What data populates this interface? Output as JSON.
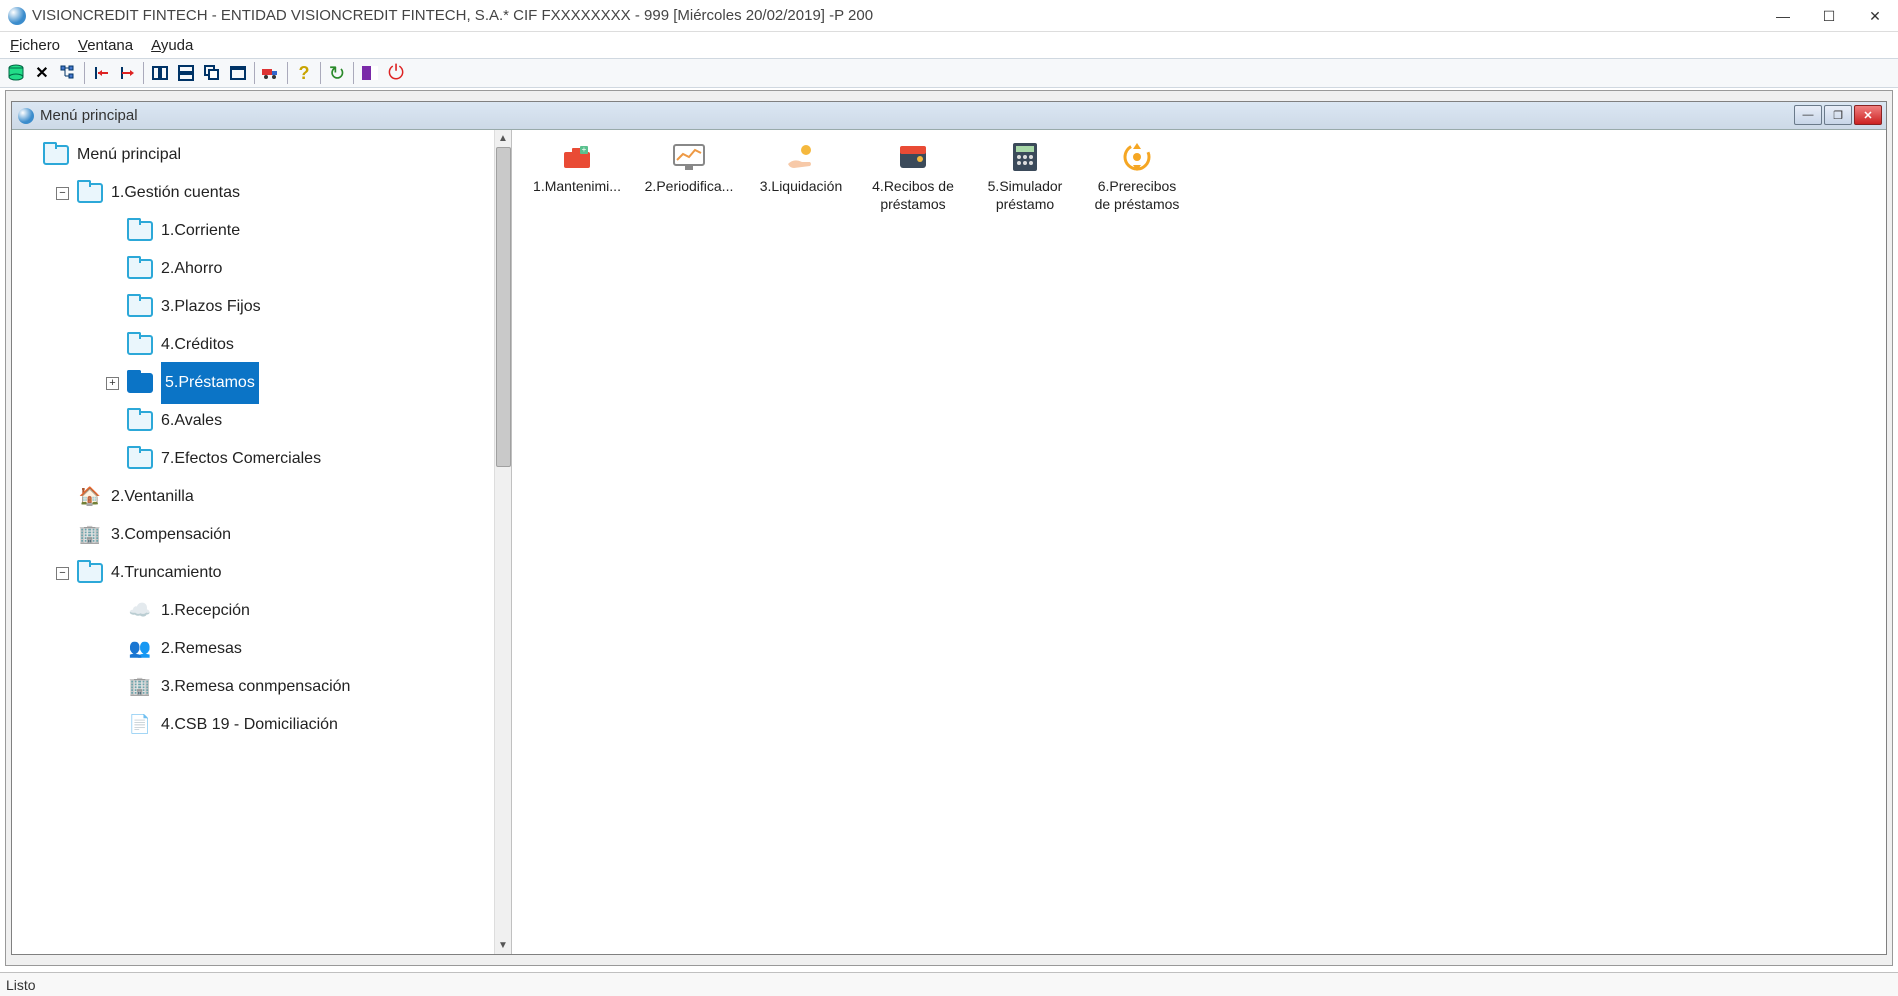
{
  "window": {
    "title": "VISIONCREDIT FINTECH - ENTIDAD VISIONCREDIT FINTECH, S.A.* CIF FXXXXXXXX - 999 [Miércoles 20/02/2019] -P 200"
  },
  "menubar": {
    "fichero": "Fichero",
    "ventana": "Ventana",
    "ayuda": "Ayuda"
  },
  "toolbar": {
    "buttons": [
      "db",
      "delete",
      "tree",
      "indent-left",
      "indent-right",
      "cols",
      "rows",
      "cascade",
      "tile",
      "truck",
      "help",
      "refresh",
      "panel1",
      "panel2"
    ]
  },
  "subwindow": {
    "title": "Menú principal"
  },
  "tree": {
    "root": "Menú principal",
    "node_gestion": "1.Gestión cuentas",
    "leaf_corriente": "1.Corriente",
    "leaf_ahorro": "2.Ahorro",
    "leaf_plazos": "3.Plazos Fijos",
    "leaf_creditos": "4.Créditos",
    "leaf_prestamos": "5.Préstamos",
    "leaf_avales": "6.Avales",
    "leaf_efectos": "7.Efectos Comerciales",
    "node_ventanilla": "2.Ventanilla",
    "node_compensacion": "3.Compensación",
    "node_truncamiento": "4.Truncamiento",
    "leaf_recepcion": "1.Recepción",
    "leaf_remesas": "2.Remesas",
    "leaf_remesa_comp": "3.Remesa conmpensación",
    "leaf_csb19": "4.CSB 19 - Domiciliación"
  },
  "content": {
    "items": [
      {
        "label": "1.Mantenimi...",
        "icon": "maintenance"
      },
      {
        "label": "2.Periodifica...",
        "icon": "period"
      },
      {
        "label": "3.Liquidación",
        "icon": "liquid"
      },
      {
        "label": "4.Recibos de préstamos",
        "icon": "receipts"
      },
      {
        "label": "5.Simulador préstamo",
        "icon": "simulator"
      },
      {
        "label": "6.Prerecibos de préstamos",
        "icon": "prereceipts"
      }
    ],
    "cap0": "1.Mantenimi...",
    "cap1": "2.Periodifica...",
    "cap2": "3.Liquidación",
    "cap3": "4.Recibos de préstamos",
    "cap4": "5.Simulador préstamo",
    "cap5": "6.Prerecibos de préstamos"
  },
  "status": {
    "text": "Listo"
  }
}
